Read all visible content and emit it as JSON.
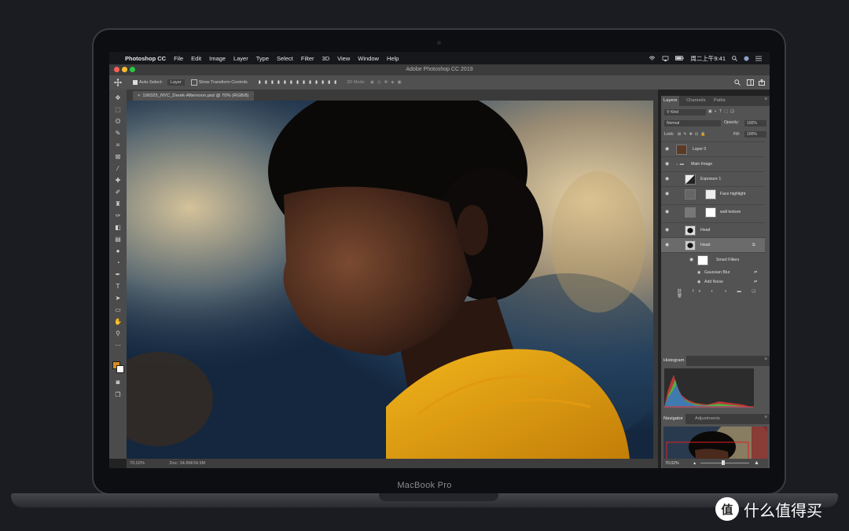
{
  "menubar": {
    "app": "Photoshop CC",
    "items": [
      "File",
      "Edit",
      "Image",
      "Layer",
      "Type",
      "Select",
      "Filter",
      "3D",
      "View",
      "Window",
      "Help"
    ],
    "clock": "周二上午9:41"
  },
  "window": {
    "title": "Adobe Photoshop CC 2019"
  },
  "options": {
    "auto_select": "Auto-Select:",
    "auto_select_value": "Layer",
    "show_transform": "Show Transform Controls",
    "mode_3d": "3D Mode:"
  },
  "document": {
    "tab": "190325_NYC_Derek-Afternoon.psd @ 70% (RGB/8)",
    "zoom": "70.02%",
    "doc_info": "Doc: 34.8M/34.9M"
  },
  "layers_panel": {
    "tabs": [
      "Layers",
      "Channels",
      "Paths"
    ],
    "kind": "Kind",
    "blend_mode": "Normal",
    "opacity_label": "Opacity:",
    "opacity_value": "100%",
    "lock_label": "Lock:",
    "fill_label": "Fill:",
    "fill_value": "100%",
    "layers": [
      {
        "name": "Layer 0"
      },
      {
        "name": "Main Image"
      },
      {
        "name": "Exposure 1"
      },
      {
        "name": "Face highlight"
      },
      {
        "name": "wall texture"
      },
      {
        "name": "Head"
      },
      {
        "name": "Head"
      },
      {
        "name": "Smart Filters"
      },
      {
        "name": "Gaussian Blur"
      },
      {
        "name": "Add Noise"
      }
    ]
  },
  "histogram": {
    "title": "Histogram"
  },
  "navigator": {
    "tabs": [
      "Navigator",
      "Adjustments"
    ],
    "zoom": "70.02%"
  },
  "laptop": {
    "model": "MacBook Pro"
  },
  "watermark": {
    "text": "什么值得买",
    "badge": "值"
  },
  "colors": {
    "ps_panel": "#535353",
    "ps_dark": "#3c3c3c",
    "foreground_swatch": "#d98b1c",
    "background_swatch": "#ffffff"
  }
}
